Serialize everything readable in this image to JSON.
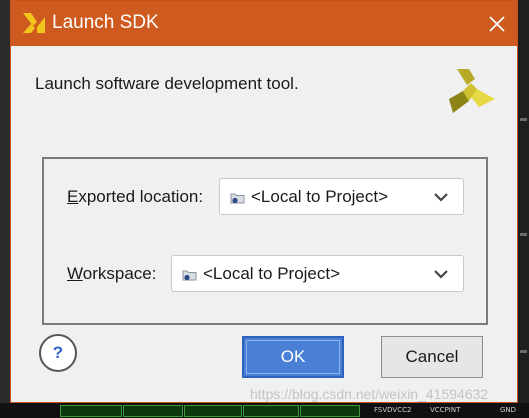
{
  "dialog": {
    "title": "Launch SDK",
    "description": "Launch software development tool.",
    "accent_color": "#cf5a1f"
  },
  "fields": {
    "exported_location": {
      "label_mnemonic": "E",
      "label_rest": "xported location:",
      "value": "<Local to Project>"
    },
    "workspace": {
      "label_mnemonic": "W",
      "label_rest": "orkspace:",
      "value": "<Local to Project>"
    }
  },
  "buttons": {
    "help": "?",
    "ok": "OK",
    "cancel": "Cancel"
  },
  "background": {
    "bottom_labels": [
      "FSVDVCC2",
      "VCCPINT",
      "GND"
    ]
  },
  "watermark": "https://blog.csdn.net/weixin_41594632",
  "icons": [
    "xilinx-logo-icon",
    "close-icon",
    "folder-icon",
    "chevron-down-icon",
    "help-icon"
  ]
}
